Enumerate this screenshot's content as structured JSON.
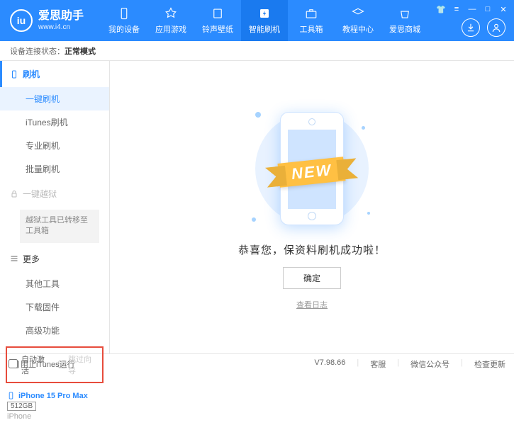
{
  "header": {
    "logo_text": "iu",
    "title": "爱思助手",
    "subtitle": "www.i4.cn",
    "nav": [
      {
        "label": "我的设备"
      },
      {
        "label": "应用游戏"
      },
      {
        "label": "铃声壁纸"
      },
      {
        "label": "智能刷机"
      },
      {
        "label": "工具箱"
      },
      {
        "label": "教程中心"
      },
      {
        "label": "爱思商城"
      }
    ]
  },
  "status": {
    "label": "设备连接状态：",
    "value": "正常模式"
  },
  "sidebar": {
    "section_flash": "刷机",
    "items_flash": [
      "一键刷机",
      "iTunes刷机",
      "专业刷机",
      "批量刷机"
    ],
    "section_jailbreak": "一键越狱",
    "jailbreak_note": "越狱工具已转移至工具箱",
    "section_more": "更多",
    "items_more": [
      "其他工具",
      "下载固件",
      "高级功能"
    ],
    "checkboxes": {
      "auto_activate": "自动激活",
      "skip_guide": "跳过向导"
    },
    "device": {
      "name": "iPhone 15 Pro Max",
      "storage": "512GB",
      "type": "iPhone"
    }
  },
  "main": {
    "ribbon": "NEW",
    "success_text": "恭喜您，保资料刷机成功啦！",
    "ok_button": "确定",
    "view_log": "查看日志"
  },
  "footer": {
    "block_itunes": "阻止iTunes运行",
    "version": "V7.98.66",
    "links": [
      "客服",
      "微信公众号",
      "检查更新"
    ]
  }
}
